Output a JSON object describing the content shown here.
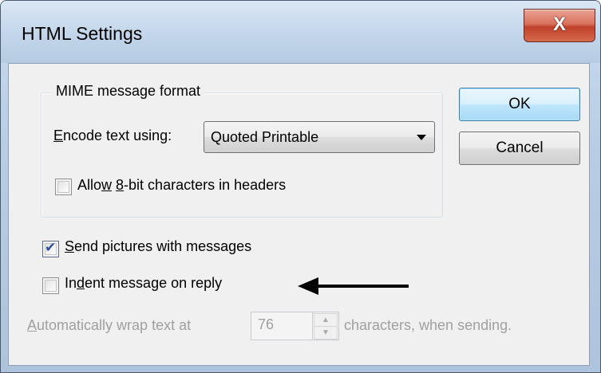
{
  "window": {
    "title": "HTML Settings",
    "close_label": "X"
  },
  "mime": {
    "group_label": "MIME message format",
    "encode_label_ul": "E",
    "encode_label_rest": "ncode text using:",
    "encode_value": "Quoted Printable",
    "allow8bit_pre": "Allo",
    "allow8bit_ul": "w",
    "allow8bit_mid": " ",
    "allow8bit_ul2": "8",
    "allow8bit_rest": "-bit characters in headers",
    "allow8bit_checked": false
  },
  "buttons": {
    "ok": "OK",
    "cancel": "Cancel"
  },
  "options": {
    "send_pictures_ul": "S",
    "send_pictures_rest": "end pictures with messages",
    "send_pictures_checked": true,
    "indent_pre": "In",
    "indent_ul": "d",
    "indent_rest": "ent message on reply",
    "indent_checked": false
  },
  "wrap": {
    "label_ul": "A",
    "label_rest": "utomatically wrap text at",
    "value": "76",
    "suffix": "characters, when sending."
  },
  "icons": {
    "checkmark": "✔",
    "spin_up": "▲",
    "spin_down": "▼"
  }
}
